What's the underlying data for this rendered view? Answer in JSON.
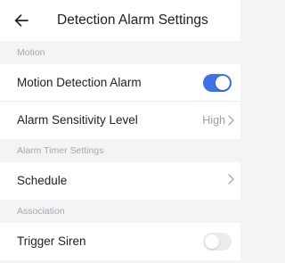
{
  "header": {
    "title": "Detection Alarm Settings",
    "back_icon": "back-arrow-icon"
  },
  "sections": {
    "motion": {
      "title": "Motion",
      "motion_alarm": {
        "label": "Motion Detection Alarm",
        "enabled": true
      },
      "sensitivity": {
        "label": "Alarm Sensitivity Level",
        "value": "High"
      }
    },
    "timer": {
      "title": "Alarm Timer Settings",
      "schedule": {
        "label": "Schedule"
      }
    },
    "association": {
      "title": "Association",
      "trigger_siren": {
        "label": "Trigger Siren",
        "enabled": false
      }
    }
  },
  "colors": {
    "accent": "#3d72e8",
    "toggle_off": "#ececef",
    "section_bg": "#f4f4f6"
  }
}
